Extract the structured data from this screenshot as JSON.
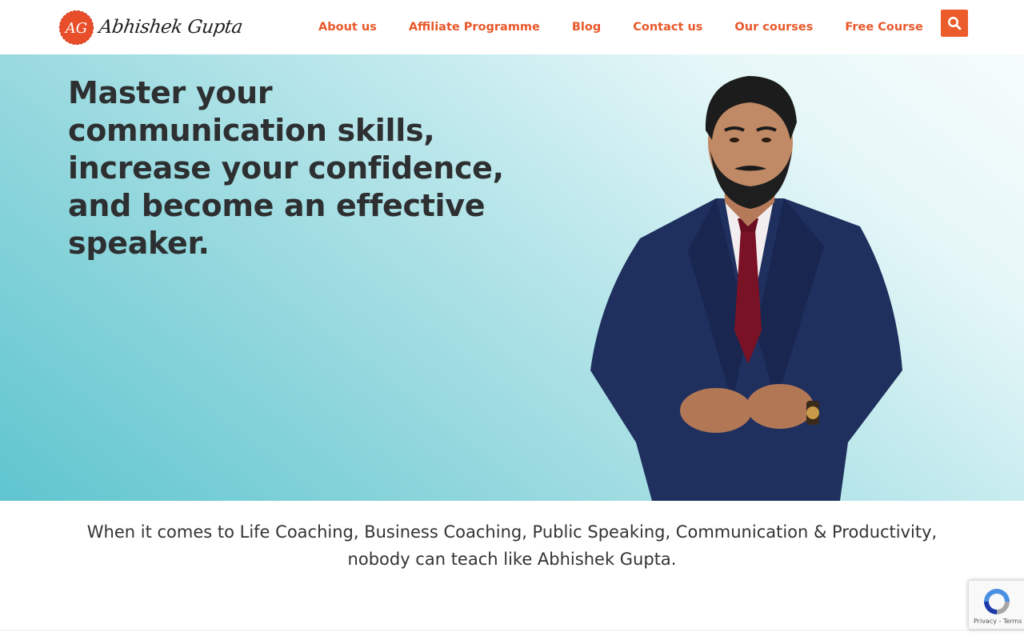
{
  "brand": {
    "logo_initials": "AG",
    "logo_text": "Abhishek Gupta",
    "accent_color": "#ec5b2a"
  },
  "nav": {
    "items": [
      {
        "label": "About us"
      },
      {
        "label": "Affiliate Programme"
      },
      {
        "label": "Blog"
      },
      {
        "label": "Contact us"
      },
      {
        "label": "Our courses"
      },
      {
        "label": "Free Course"
      }
    ],
    "search_icon": "search-icon"
  },
  "hero": {
    "headline": "Master your communication skills, increase your confidence, and become an effective speaker.",
    "image_subject": "man-in-navy-suit-portrait"
  },
  "tagline": "When it comes to Life Coaching, Business Coaching, Public Speaking, Communication & Productivity, nobody can teach like Abhishek Gupta.",
  "recaptcha": {
    "privacy_label": "Privacy",
    "separator": " - ",
    "terms_label": "Terms"
  }
}
